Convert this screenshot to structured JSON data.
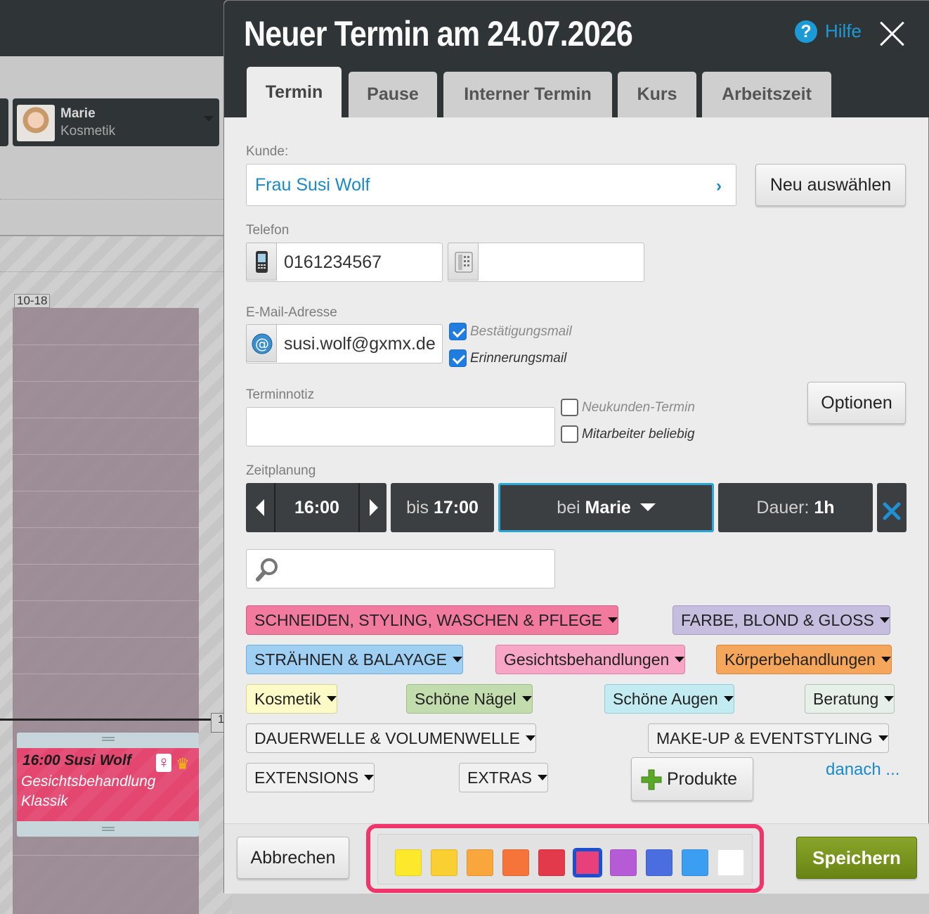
{
  "calendar": {
    "staff": {
      "name": "Marie",
      "role": "Kosmetik"
    },
    "time_range_label": "10-18",
    "now_marker": "1",
    "appointment": {
      "time_customer": "16:00 Susi Wolf",
      "service": "Gesichtsbehandlung Klassik",
      "female_icon": "♀",
      "crown_icon": "♛"
    }
  },
  "dialog": {
    "title": "Neuer Termin am 24.07.2026",
    "help_label": "Hilfe",
    "tabs": [
      {
        "label": "Termin",
        "active": true
      },
      {
        "label": "Pause"
      },
      {
        "label": "Interner Termin"
      },
      {
        "label": "Kurs"
      },
      {
        "label": "Arbeitszeit"
      }
    ],
    "customer": {
      "label": "Kunde:",
      "value": "Frau Susi Wolf",
      "select_button": "Neu auswählen"
    },
    "phone": {
      "label": "Telefon",
      "mobile_value": "0161234567",
      "landline_value": ""
    },
    "email": {
      "label": "E-Mail-Adresse",
      "value": "susi.wolf@gxmx.de",
      "confirmation_mail": {
        "label": "Bestätigungsmail",
        "checked": true
      },
      "reminder_mail": {
        "label": "Erinnerungsmail",
        "checked": true
      }
    },
    "note": {
      "label": "Terminnotiz",
      "value": "",
      "new_customer": {
        "label": "Neukunden-Termin",
        "checked": false
      },
      "any_employee": {
        "label": "Mitarbeiter beliebig",
        "checked": false
      },
      "options_button": "Optionen"
    },
    "schedule": {
      "label": "Zeitplanung",
      "start_time": "16:00",
      "end_prefix": "bis",
      "end_time": "17:00",
      "staff_prefix": "bei",
      "staff": "Marie",
      "duration_prefix": "Dauer:",
      "duration": "1h"
    },
    "search": {
      "value": ""
    },
    "categories": [
      {
        "label": "SCHNEIDEN, STYLING, WASCHEN & PFLEGE",
        "color": "#f27a9e"
      },
      {
        "label": "FARBE, BLOND & GLOSS",
        "color": "#c5bedf"
      },
      {
        "label": "STRÄHNEN & BALAYAGE",
        "color": "#9fcff3"
      },
      {
        "label": "Gesichtsbehandlungen",
        "color": "#f7a6c6"
      },
      {
        "label": "Körperbehandlungen",
        "color": "#f6a65a"
      },
      {
        "label": "Kosmetik",
        "color": "#fcfbc7"
      },
      {
        "label": "Schöne Nägel",
        "color": "#c3dcae"
      },
      {
        "label": "Schöne Augen",
        "color": "#c3ebf2"
      },
      {
        "label": "Beratung",
        "color": "#e6efe8"
      },
      {
        "label": "DAUERWELLE & VOLUMENWELLE",
        "color": "#f1f1f1"
      },
      {
        "label": "MAKE-UP & EVENTSTYLING",
        "color": "#f1f1f1"
      },
      {
        "label": "EXTENSIONS",
        "color": "#f1f1f1"
      },
      {
        "label": "EXTRAS",
        "color": "#f1f1f1"
      }
    ],
    "products_button": "Produkte",
    "after_link": "danach ...",
    "footer": {
      "cancel_button": "Abbrechen",
      "save_button": "Speichern",
      "colors": [
        "#fde92b",
        "#f9cf31",
        "#f9a63c",
        "#f6743a",
        "#e23a4b",
        "#e8407a",
        "#b55bd6",
        "#4a6de0",
        "#3b9ef0",
        "#ffffff"
      ],
      "selected_color_index": 5
    }
  }
}
